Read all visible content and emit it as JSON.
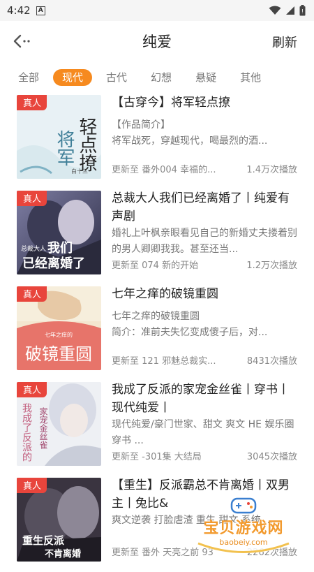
{
  "status": {
    "time": "4:42",
    "notif": "A"
  },
  "header": {
    "title": "纯爱",
    "refresh": "刷新"
  },
  "tabs": [
    "全部",
    "现代",
    "古代",
    "幻想",
    "悬疑",
    "其他"
  ],
  "items": [
    {
      "badge": "真人",
      "title": "【古穿今】将军轻点撩",
      "desc1": "【作品简介】",
      "desc2": "将军战死，穿越现代，喝最烈的酒...",
      "latest": "更新至  番外004 幸福的...",
      "plays": "1.4万次播放",
      "cover_text": "将军轻点撩",
      "cover_author": "白十三"
    },
    {
      "badge": "真人",
      "title": "总裁大人我们已经离婚了丨纯爱有声剧",
      "desc1": "婚礼上叶枫亲眼看见自己的新婚丈夫搂着别的男人卿卿我我。甚至还当...",
      "desc2": "",
      "latest": "更新至  074 新的开始",
      "plays": "1.2万次播放",
      "cover_text": "我们已经离婚了",
      "cover_small": "总裁大人"
    },
    {
      "badge": "真人",
      "title": "七年之痒的破镜重圆",
      "desc1": "七年之痒的破镜重圆",
      "desc2": "简介：准前夫失忆变成傻子后，对...",
      "latest": "更新至  121 邪魅总裁实...",
      "plays": "8431次播放",
      "cover_text": "破镜重圆",
      "cover_small": "七年之痒的"
    },
    {
      "badge": "真人",
      "title": "我成了反派的家宠金丝雀丨穿书丨现代纯爱丨",
      "desc1": "现代纯爱/豪门世家、甜文 爽文 HE 娱乐圈 穿书 ...",
      "desc2": "",
      "latest": "更新至  -301集 大结局",
      "plays": "3045次播放",
      "cover_text": "我成了反派的家宠金丝雀"
    },
    {
      "badge": "真人",
      "title": "【重生】反派霸总不肯离婚丨双男主丨兔比&",
      "desc1": "爽文逆袭 打脸虐渣 重生 甜文 系统 ...",
      "desc2": "",
      "latest": "更新至  番外 天亮之前 93",
      "plays": "2262次播放",
      "cover_text": "重生反派霸总不肯离婚"
    }
  ],
  "watermark": {
    "text": "宝贝游戏网",
    "url": "baobeiy.com"
  }
}
